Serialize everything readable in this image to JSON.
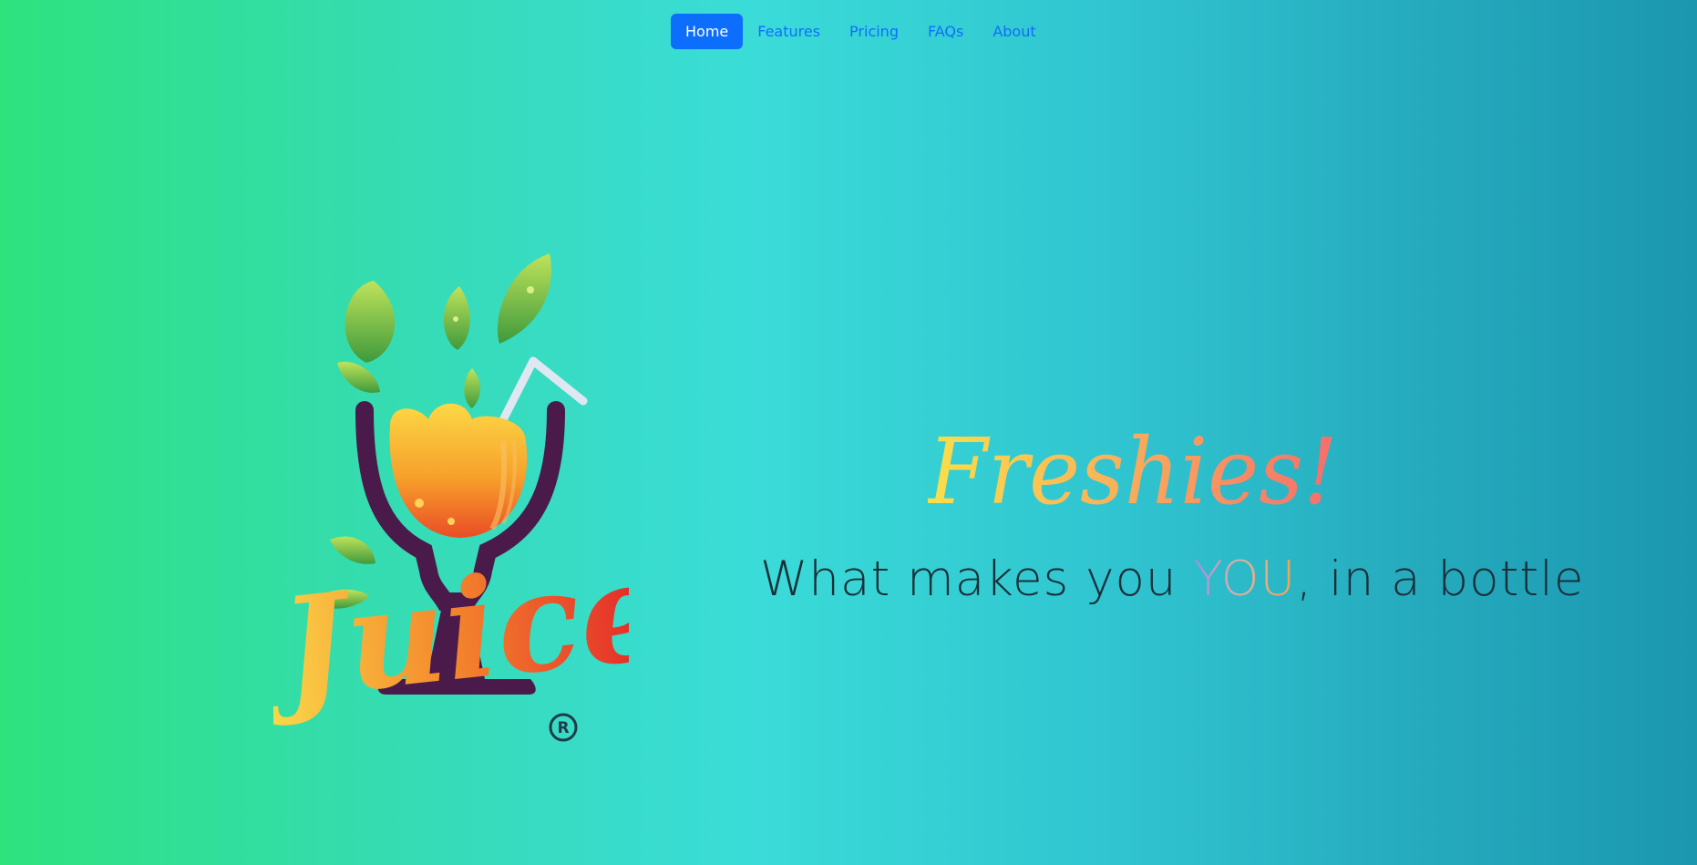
{
  "nav": {
    "items": [
      {
        "label": "Home",
        "active": true
      },
      {
        "label": "Features",
        "active": false
      },
      {
        "label": "Pricing",
        "active": false
      },
      {
        "label": "FAQs",
        "active": false
      },
      {
        "label": "About",
        "active": false
      }
    ]
  },
  "logo": {
    "wordmark": "Juice",
    "registered_mark": "R"
  },
  "hero": {
    "title": "Freshies!",
    "tagline_pre": "What makes you ",
    "tagline_highlight": "YOU",
    "tagline_post": ", in a bottle"
  },
  "colors": {
    "nav_accent": "#0d6efd",
    "background_start": "#2ee27e",
    "background_end": "#1b97b0",
    "title_gradient_start": "#f9e04a",
    "title_gradient_end": "#f56d6d",
    "tagline_text": "#1b2e38"
  }
}
